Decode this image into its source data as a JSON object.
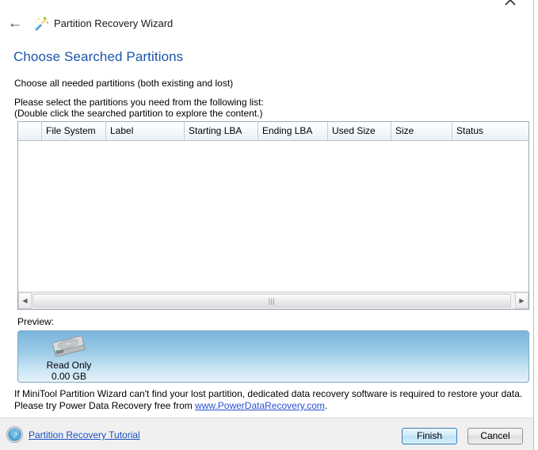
{
  "window": {
    "app_title": "Partition Recovery Wizard",
    "back_icon": "←",
    "collapse_icon": "⌃",
    "wizard_icon": "wizard-icon"
  },
  "page": {
    "heading": "Choose Searched Partitions",
    "subtitle": "Choose all needed partitions (both existing and lost)",
    "instruction_line1": "Please select the partitions you need from the following list:",
    "instruction_line2": "(Double click the searched partition to explore the content.)"
  },
  "table": {
    "columns": [
      "",
      "File System",
      "Label",
      "Starting LBA",
      "Ending LBA",
      "Used Size",
      "Size",
      "Status"
    ],
    "rows": []
  },
  "scrollbar": {
    "left_arrow": "◀",
    "right_arrow": "▶",
    "grip": "|||"
  },
  "preview": {
    "label": "Preview:",
    "disk_icon": "hard-disk-icon",
    "status": "Read Only",
    "size": "0.00 GB"
  },
  "note": {
    "text_before": "If MiniTool Partition Wizard can't find your lost partition, dedicated data recovery software is required to restore your data. Please try Power Data Recovery free from ",
    "link_text": "www.PowerDataRecovery.com",
    "text_after": "."
  },
  "footer": {
    "help_icon": "question-mark-icon",
    "tutorial_link": "Partition Recovery Tutorial",
    "finish_label": "Finish",
    "cancel_label": "Cancel"
  },
  "colors": {
    "heading_blue": "#1b54ab",
    "link_blue": "#2b4fd0",
    "preview_top": "#7ab5dc",
    "preview_bottom": "#e4f2fa",
    "accent_edge": "#b3d080"
  }
}
